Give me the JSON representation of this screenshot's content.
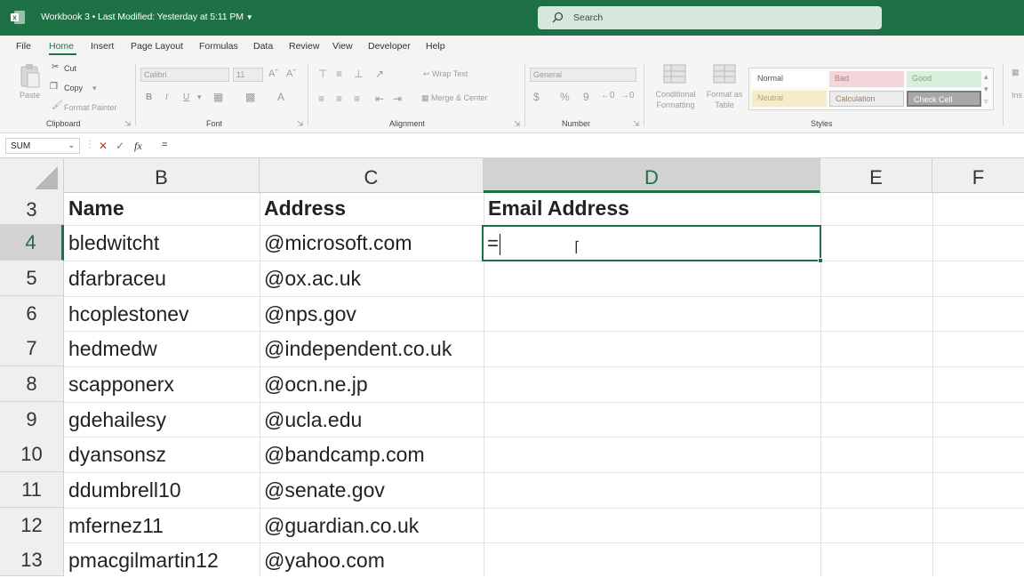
{
  "titlebar": {
    "document_title": "Workbook 3 • Last Modified: Yesterday at 5:11 PM",
    "search_placeholder": "Search",
    "icons": [
      "excel-app-icon",
      "chevron-down-icon",
      "search-icon"
    ]
  },
  "menu": {
    "items": [
      "File",
      "Home",
      "Insert",
      "Page Layout",
      "Formulas",
      "Data",
      "Review",
      "View",
      "Developer",
      "Help"
    ],
    "active": "Home"
  },
  "ribbon": {
    "clipboard": {
      "paste": "Paste",
      "cut": "Cut",
      "copy": "Copy",
      "format_painter": "Format Painter",
      "label": "Clipboard"
    },
    "font": {
      "font_name": "Calibri",
      "font_size": "11",
      "bold": "B",
      "italic": "I",
      "underline": "U",
      "label": "Font"
    },
    "alignment": {
      "wrap_text": "Wrap Text",
      "merge_center": "Merge & Center",
      "label": "Alignment"
    },
    "number": {
      "format": "General",
      "currency": "$",
      "percent": "%",
      "comma": "9",
      "label": "Number"
    },
    "styles_group": {
      "conditional_formatting": "Conditional Formatting",
      "format_as_table": "Format as Table",
      "cells": [
        {
          "label": "Normal",
          "bg": "#ffffff",
          "fg": "#555555"
        },
        {
          "label": "Bad",
          "bg": "#f2d6da",
          "fg": "#b08088"
        },
        {
          "label": "Good",
          "bg": "#d8efdc",
          "fg": "#7ea283"
        },
        {
          "label": "Neutral",
          "bg": "#f6ecc8",
          "fg": "#b0a47c"
        },
        {
          "label": "Calculation",
          "bg": "#ececec",
          "fg": "#a87c5e"
        },
        {
          "label": "Check Cell",
          "bg": "#a8a8a8",
          "fg": "#ffffff"
        }
      ],
      "label": "Styles"
    },
    "insert_partial": "Ins"
  },
  "formula_bar": {
    "name_box": "SUM",
    "cancel": "✕",
    "enter": "✓",
    "fx": "fx",
    "formula": "="
  },
  "sheet": {
    "columns": [
      "B",
      "C",
      "D",
      "E",
      "F"
    ],
    "selected_column": "D",
    "rows": [
      {
        "num": "3",
        "b": "Name",
        "c": "Address",
        "d": "Email Address",
        "header": true
      },
      {
        "num": "4",
        "b": "bledwitcht",
        "c": "@microsoft.com",
        "d": ""
      },
      {
        "num": "5",
        "b": "dfarbraceu",
        "c": "@ox.ac.uk",
        "d": ""
      },
      {
        "num": "6",
        "b": "hcoplestonev",
        "c": "@nps.gov",
        "d": ""
      },
      {
        "num": "7",
        "b": "hedmedw",
        "c": "@independent.co.uk",
        "d": ""
      },
      {
        "num": "8",
        "b": "scapponerx",
        "c": "@ocn.ne.jp",
        "d": ""
      },
      {
        "num": "9",
        "b": "gdehailesy",
        "c": "@ucla.edu",
        "d": ""
      },
      {
        "num": "10",
        "b": "dyansonsz",
        "c": "@bandcamp.com",
        "d": ""
      },
      {
        "num": "11",
        "b": "ddumbrell10",
        "c": "@senate.gov",
        "d": ""
      },
      {
        "num": "12",
        "b": "mfernez11",
        "c": "@guardian.co.uk",
        "d": ""
      },
      {
        "num": "13",
        "b": "pmacgilmartin12",
        "c": "@yahoo.com",
        "d": ""
      }
    ],
    "selected_row": "4",
    "active_cell_value": "="
  },
  "colors": {
    "accent": "#1e7145",
    "header_bg": "#efefef",
    "selected_header_bg": "#d2d2d2"
  }
}
